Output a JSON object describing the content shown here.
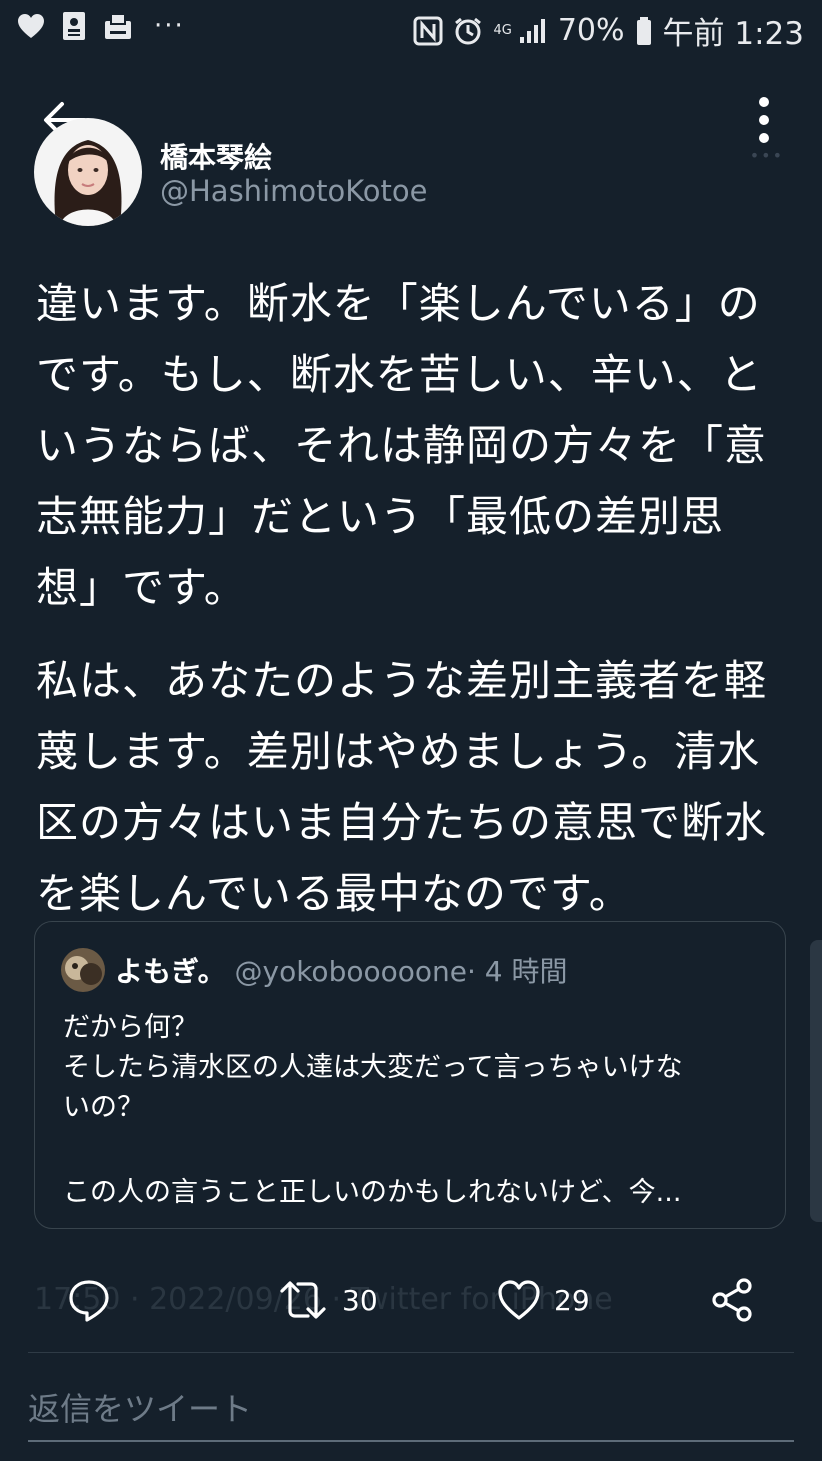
{
  "status_bar": {
    "network": "4G",
    "battery": "70%",
    "time": "午前 1:23",
    "more": "···"
  },
  "author": {
    "name": "橋本琴絵",
    "handle": "@HashimotoKotoe"
  },
  "tweet": {
    "paragraphs": [
      "違います。断水を「楽しんでいる」の\nです。もし、断水を苦しい、辛い、と\nいうならば、それは静岡の方々を「意\n志無能力」だという「最低の差別思\n想」です。",
      "私は、あなたのような差別主義者を軽\n蔑します。差別はやめましょう。清水\n区の方々はいま自分たちの意思で断水\nを楽しんでいる最中なのです。"
    ]
  },
  "quote": {
    "name": "よもぎ。",
    "handle": "@yokobooooone",
    "separator": "·",
    "time": "4 時間",
    "text": "だから何？\nそしたら清水区の人達は大変だって言っちゃいけな\nいの？",
    "text_truncated": "この人の言うこと正しいのかもしれないけど、今..."
  },
  "meta": {
    "text": "17:50 · 2022/09/26 · Twitter for iPhone"
  },
  "actions": {
    "retweets": "30",
    "likes": "29"
  },
  "reply": {
    "placeholder": "返信をツイート"
  },
  "colors": {
    "background": "#15202b",
    "secondary_text": "#8b98a5",
    "border": "#38444d"
  }
}
